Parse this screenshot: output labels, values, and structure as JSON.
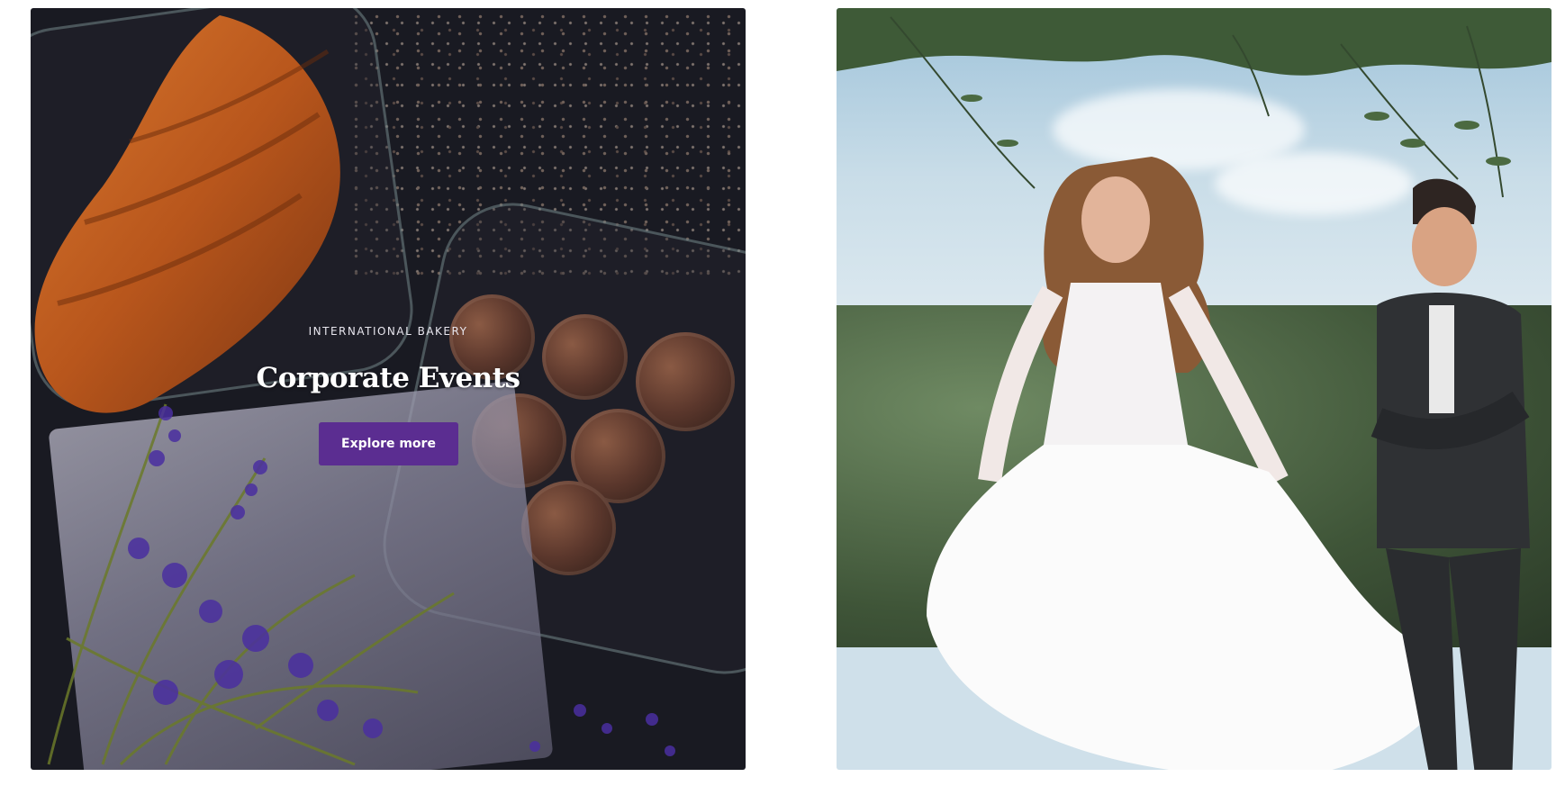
{
  "hero": {
    "eyebrow": "INTERNATIONAL BAKERY",
    "title": "Corporate Events",
    "cta_label": "Explore more"
  },
  "images": {
    "left": "bakery-still-life",
    "right": "wedding-couple"
  },
  "colors": {
    "cta_background": "#5b2d91",
    "left_card_background": "#191a22"
  }
}
